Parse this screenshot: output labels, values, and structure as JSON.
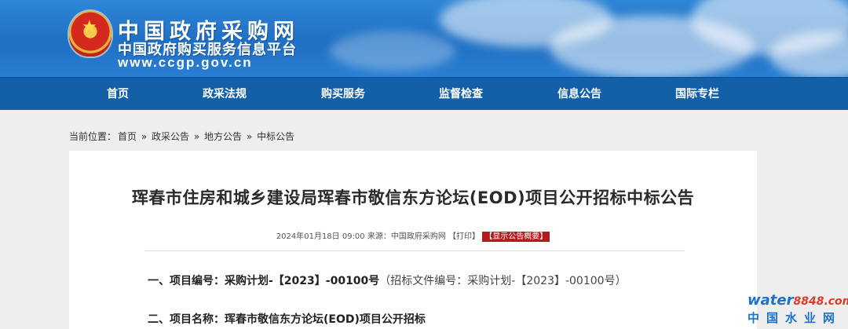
{
  "header": {
    "title_cn": "中国政府采购网",
    "subtitle_cn": "中国政府购买服务信息平台",
    "url": "www.ccgp.gov.cn"
  },
  "nav": {
    "items": [
      "首页",
      "政采法规",
      "购买服务",
      "监督检查",
      "信息公告",
      "国际专栏"
    ]
  },
  "breadcrumb": {
    "label": "当前位置：",
    "items": [
      "首页",
      "政采公告",
      "地方公告",
      "中标公告"
    ],
    "separator": "»"
  },
  "article": {
    "title": "珲春市住房和城乡建设局珲春市敬信东方论坛(EOD)项目公开招标中标公告",
    "meta_date": "2024年01月18日 09:00",
    "meta_source": "来源：中国政府采购网",
    "print_label": "【打印】",
    "summary_label": "【显示公告概要】",
    "line1_prefix": "一、项目编号：采购计划-【2023】-00100号",
    "line1_paren": "（招标文件编号：采购计划-【2023】-00100号）",
    "line2": "二、项目名称：珲春市敬信东方论坛(EOD)项目公开招标"
  },
  "watermark": {
    "brand": "water",
    "number": "8848",
    "suffix": ".com",
    "cn": "中国水业网"
  },
  "colors": {
    "header_blue": "#1f6fc4",
    "nav_blue": "#1460a8",
    "summary_red": "#b31c1c"
  }
}
